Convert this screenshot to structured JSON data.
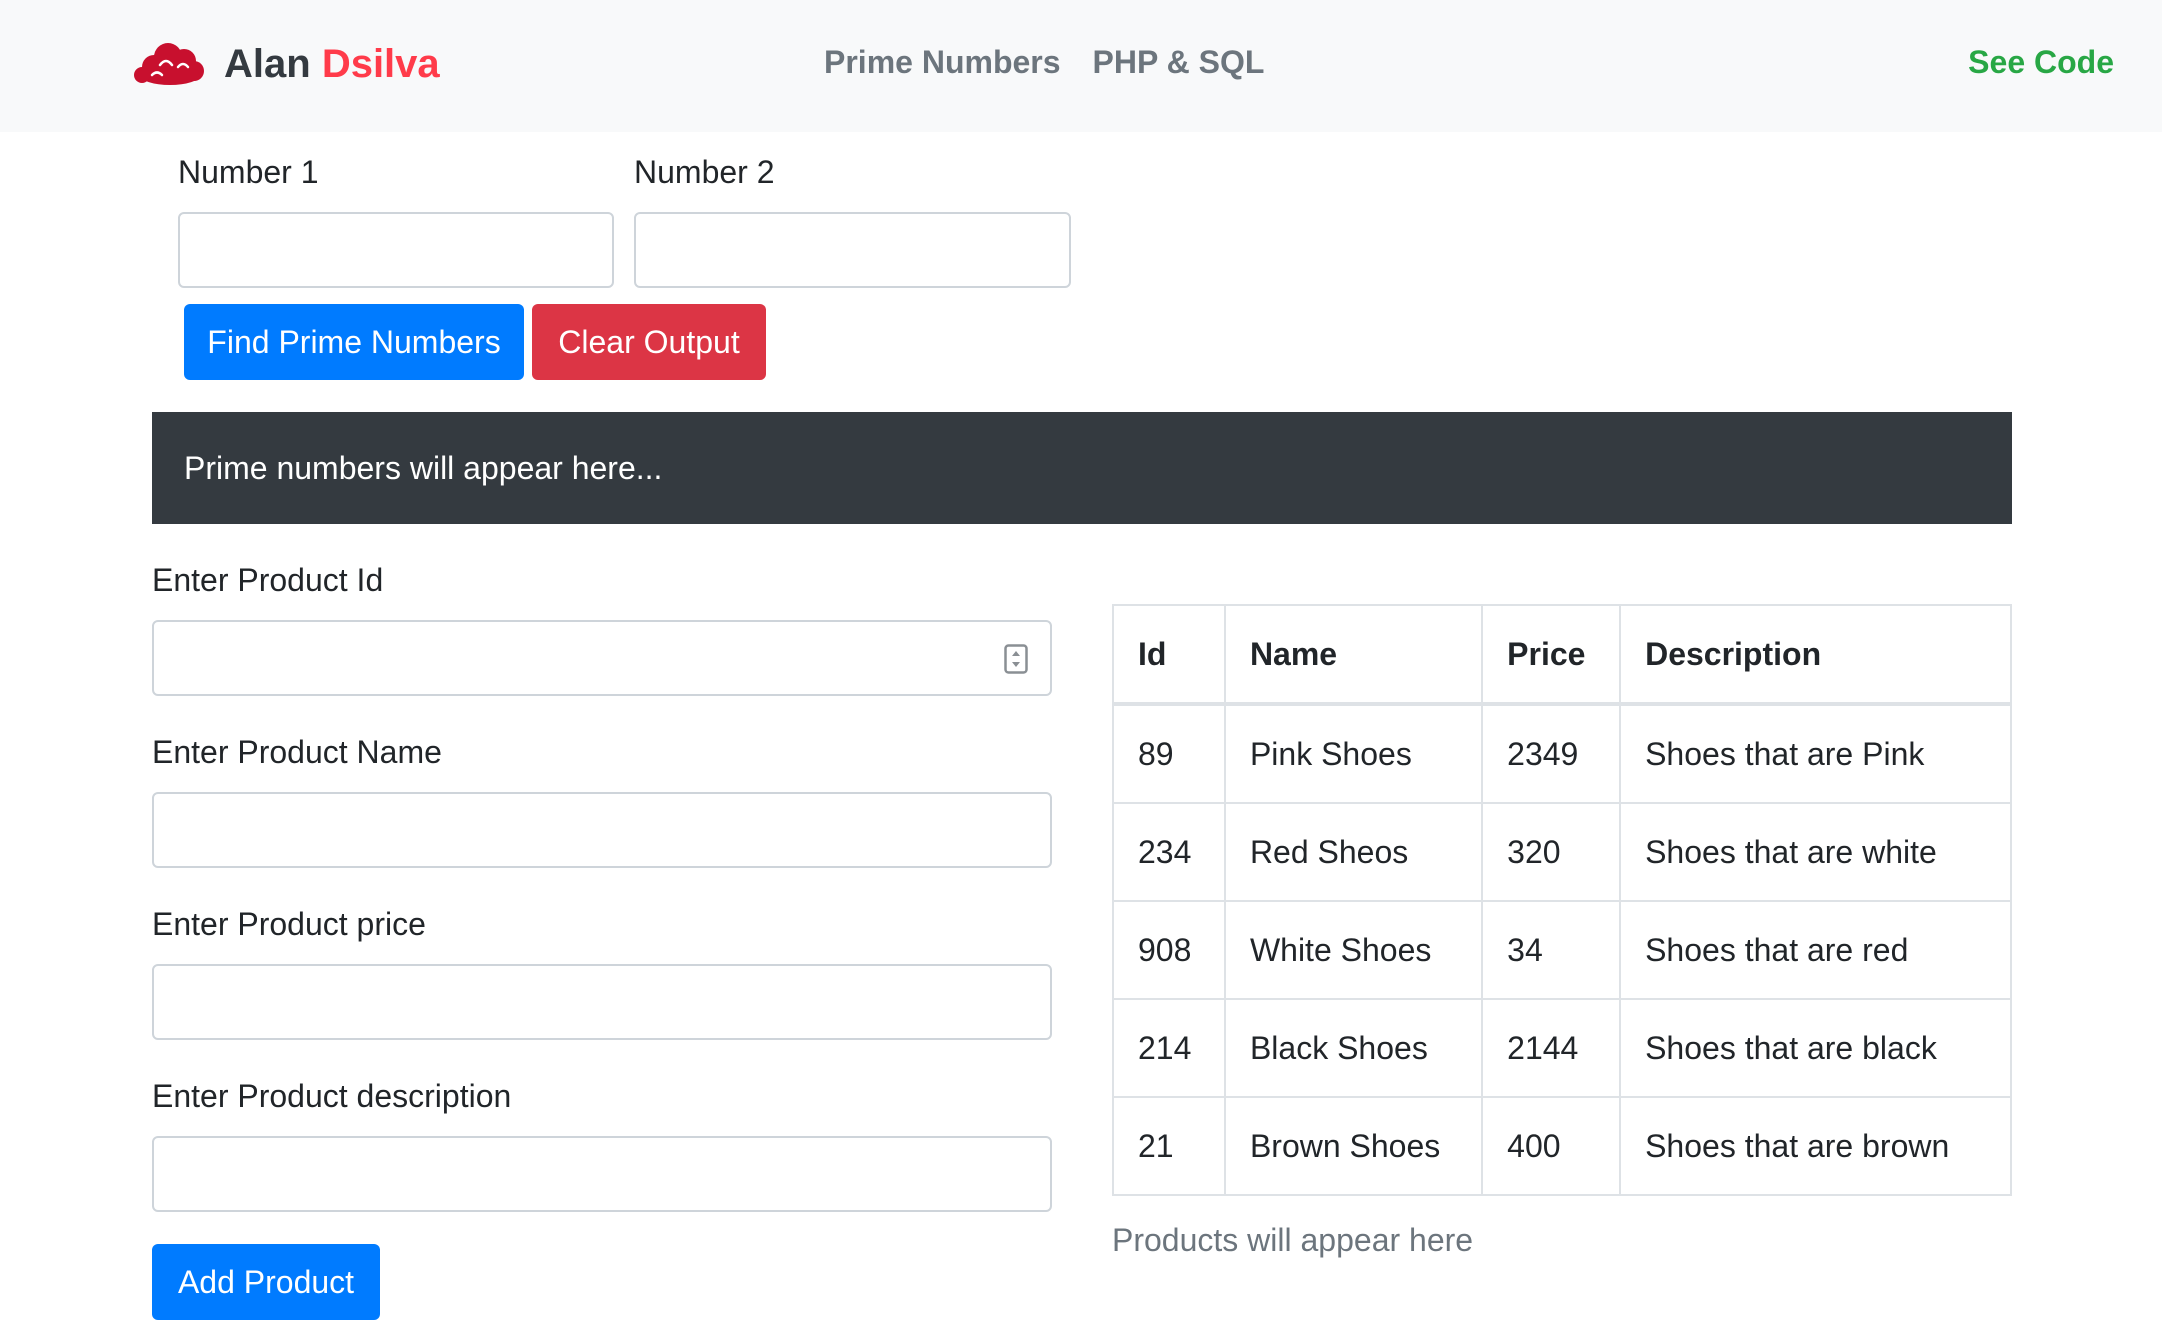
{
  "nav": {
    "brand_first": "Alan",
    "brand_last": "Dsilva",
    "links": [
      "Prime Numbers",
      "PHP & SQL"
    ],
    "see_code": "See Code"
  },
  "prime": {
    "number1_label": "Number 1",
    "number2_label": "Number 2",
    "number1_value": "",
    "number2_value": "",
    "find_button": "Find Prime Numbers",
    "clear_button": "Clear Output",
    "output_text": "Prime numbers will appear here..."
  },
  "product_form": {
    "id_label": "Enter Product Id",
    "name_label": "Enter Product Name",
    "price_label": "Enter Product price",
    "description_label": "Enter Product description",
    "id_value": "",
    "name_value": "",
    "price_value": "",
    "description_value": "",
    "add_button": "Add Product"
  },
  "products_table": {
    "headers": [
      "Id",
      "Name",
      "Price",
      "Description"
    ],
    "rows": [
      [
        "89",
        "Pink Shoes",
        "2349",
        "Shoes that are Pink"
      ],
      [
        "234",
        "Red Sheos",
        "320",
        "Shoes that are white"
      ],
      [
        "908",
        "White Shoes",
        "34",
        "Shoes that are red"
      ],
      [
        "214",
        "Black Shoes",
        "2144",
        "Shoes that are black"
      ],
      [
        "21",
        "Brown Shoes",
        "400",
        "Shoes that are brown"
      ]
    ],
    "footer_text": "Products will appear here"
  },
  "colors": {
    "navbar_bg": "#f8f9fa",
    "brand_accent": "#ff3b4a",
    "see_code": "#28a745",
    "primary": "#007bff",
    "danger": "#dc3545",
    "output_bg": "#343a40",
    "logo_cloud": "#c8102e"
  },
  "icons": {
    "logo": "red-cloud-logo-icon",
    "number_spinner": "number-spinner-icon"
  }
}
